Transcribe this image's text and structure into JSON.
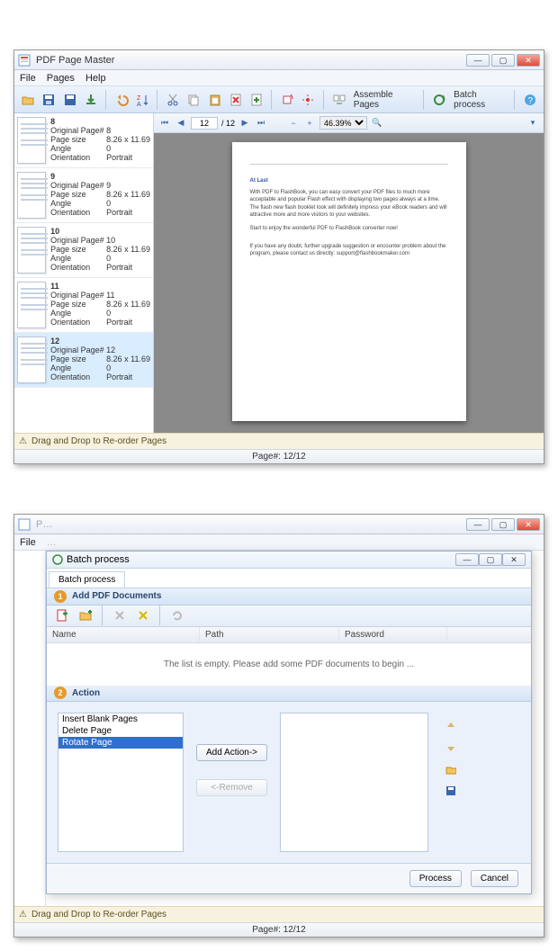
{
  "app": {
    "title": "PDF Page Master"
  },
  "menu": [
    "File",
    "Pages",
    "Help"
  ],
  "toolbar": {
    "assemble": "Assemble Pages",
    "batch": "Batch process"
  },
  "viewer": {
    "current_page": "12",
    "total_pages": "/ 12",
    "zoom": "46.39%"
  },
  "thumbs": [
    {
      "n": "8",
      "orig": "8",
      "size": "8.26 x 11.69",
      "angle": "0",
      "orient": "Portrait"
    },
    {
      "n": "9",
      "orig": "9",
      "size": "8.26 x 11.69",
      "angle": "0",
      "orient": "Portrait"
    },
    {
      "n": "10",
      "orig": "10",
      "size": "8.26 x 11.69",
      "angle": "0",
      "orient": "Portrait"
    },
    {
      "n": "11",
      "orig": "11",
      "size": "8.26 x 11.69",
      "angle": "0",
      "orient": "Portrait"
    },
    {
      "n": "12",
      "orig": "12",
      "size": "8.26 x 11.69",
      "angle": "0",
      "orient": "Portrait"
    }
  ],
  "thumb_labels": {
    "orig": "Original Page#",
    "size": "Page size",
    "angle": "Angle",
    "orient": "Orientation"
  },
  "hint": "Drag and Drop to Re-order Pages",
  "status": "Page#: 12/12",
  "doc": {
    "heading": "At Last",
    "p1": "With PDF to FlashBook, you can easy convert your PDF files to much more acceptable and popular Flash effect with displaying two pages always at a time. The flash new flash booklet look will definitely impress your eBook readers and will attractive more and more visitors to your websites.",
    "p2": "Start to enjoy the wonderful PDF to FlashBook converter now!",
    "p3": "If you have any doubt, further upgrade suggestion or encounter problem about the program, please contact us directly: support@flashbookmaker.com"
  },
  "batch": {
    "title": "Batch process",
    "tab": "Batch process",
    "sec1": "Add PDF Documents",
    "sec2": "Action",
    "cols": {
      "name": "Name",
      "path": "Path",
      "password": "Password"
    },
    "empty": "The list is empty. Please add some PDF documents to begin ...",
    "actions": [
      "Insert Blank Pages",
      "Delete Page",
      "Rotate Page"
    ],
    "add_action": "Add Action->",
    "remove": "<-Remove",
    "process": "Process",
    "cancel": "Cancel"
  }
}
